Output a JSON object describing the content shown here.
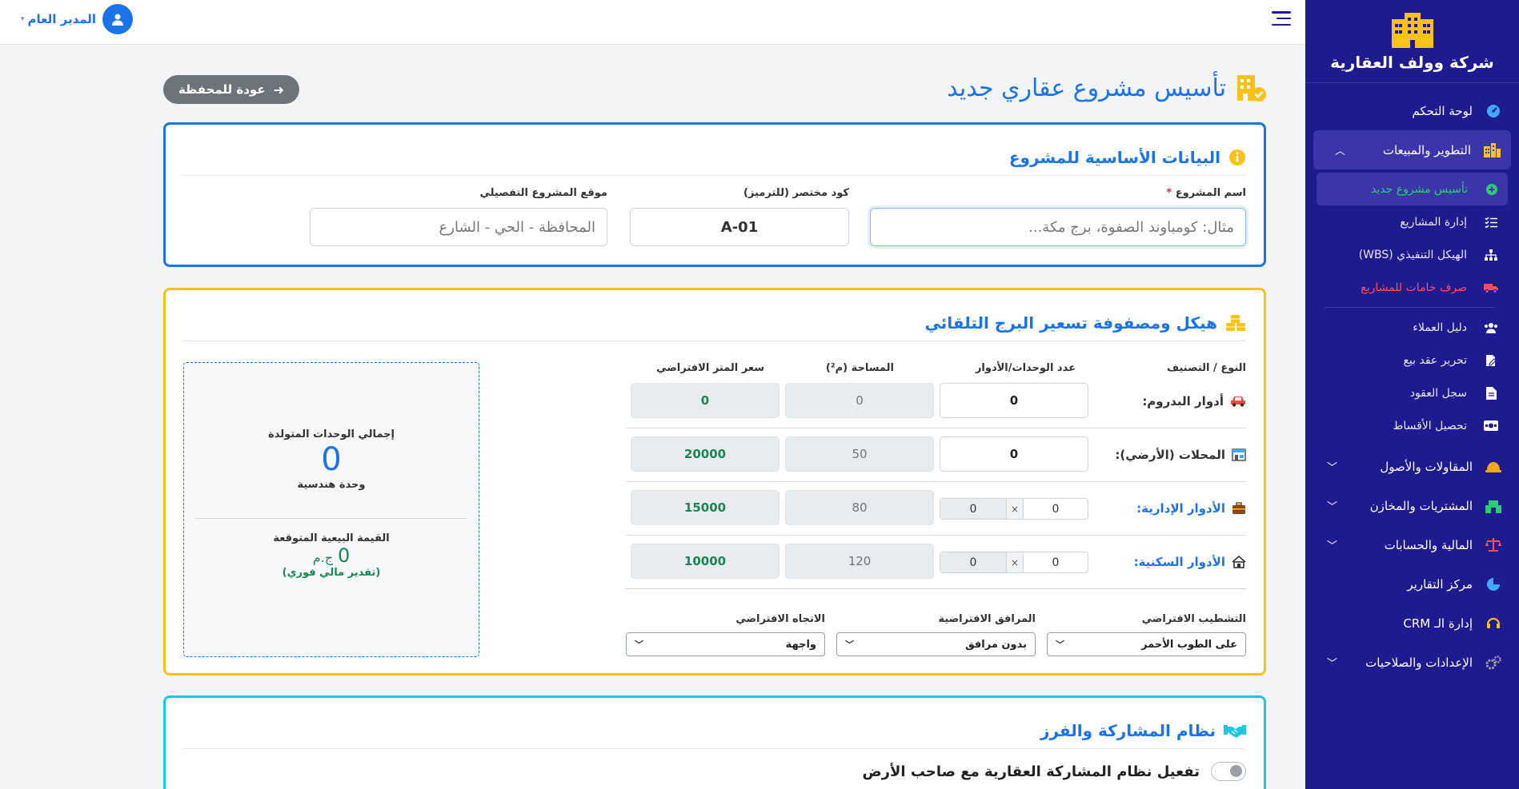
{
  "brand": {
    "name": "شركة وولف العقارية",
    "logo_icon": "building-icon",
    "color": "#f8c21a"
  },
  "colors": {
    "sidebar_bg": "#1e1a8f",
    "primary": "#1a73e8",
    "warning": "#f8c21a",
    "info": "#1fc6e0",
    "success": "#198754",
    "danger": "#ff4d5e"
  },
  "topbar": {
    "user_name": "المدير العام",
    "menu_icon": "hamburger-icon"
  },
  "nav": {
    "dashboard": "لوحة التحكم",
    "dev_sales": "التطوير والمبيعات",
    "sub": {
      "new_project": "تأسيس مشروع جديد",
      "manage_projects": "إدارة المشاريع",
      "wbs": "الهيكل التنفيذي (WBS)",
      "materials": "صرف خامات للمشاريع",
      "clients": "دليل العملاء",
      "sale_contract": "تحرير عقد بيع",
      "contracts_log": "سجل العقود",
      "installments": "تحصيل الأقساط"
    },
    "contractors": "المقاولات والأصول",
    "purchases": "المشتريات والمخازن",
    "finance": "المالية والحسابات",
    "reports": "مركز التقارير",
    "crm": "إدارة الـ CRM",
    "settings": "الإعدادات والصلاحيات"
  },
  "page": {
    "title": "تأسيس مشروع عقاري جديد",
    "back_label": "عودة للمحفظة"
  },
  "basic": {
    "title": "البيانات الأساسية للمشروع",
    "name_label": "اسم المشروع",
    "required_mark": "*",
    "name_placeholder": "مثال: كومباوند الصفوة، برج مكة...",
    "code_label": "كود مختصر (للترميز)",
    "code_value": "A-01",
    "location_label": "موقع المشروع التفصيلي",
    "location_placeholder": "المحافظة - الحي - الشارع"
  },
  "matrix": {
    "title": "هيكل ومصفوفة تسعير البرج التلقائي",
    "headers": {
      "type": "النوع / التصنيف",
      "count": "عدد الوحدات/الأدوار",
      "area": "المساحة (م²)",
      "price": "سعر المتر الافتراضي"
    },
    "rows": [
      {
        "label": "أدوار البدروم:",
        "icon": "car-icon",
        "count": "0",
        "area": "0",
        "price": "0"
      },
      {
        "label": "المحلات (الأرضي):",
        "icon": "store-icon",
        "count": "0",
        "area": "50",
        "price": "20000"
      },
      {
        "label": "الأدوار الإدارية:",
        "icon": "briefcase-icon",
        "floors": "0",
        "times": "×",
        "units": "0",
        "area": "80",
        "price": "15000"
      },
      {
        "label": "الأدوار السكنية:",
        "icon": "house-icon",
        "floors": "0",
        "times": "×",
        "units": "0",
        "area": "120",
        "price": "10000"
      }
    ],
    "finishing_label": "التشطيب الافتراضي",
    "finishing_value": "على الطوب الأحمر",
    "facilities_label": "المرافق الافتراضية",
    "facilities_value": "بدون مرافق",
    "direction_label": "الاتجاه الافتراضي",
    "direction_value": "واجهة",
    "summary": {
      "units_caption": "إجمالي الوحدات المتولدة",
      "units_value": "0",
      "units_unit": "وحدة هندسية",
      "value_caption": "القيمة البيعية المتوقعة",
      "value_amount": "0",
      "value_currency": "ج.م",
      "value_note": "(تقدير مالي فوري)"
    }
  },
  "partnership": {
    "title": "نظام المشاركة والفرز",
    "toggle_label": "تفعيل نظام المشاركة العقارية مع صاحب الأرض",
    "toggle_on": false
  }
}
